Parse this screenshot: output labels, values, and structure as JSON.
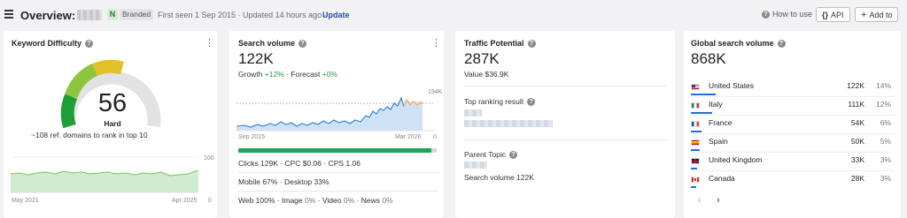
{
  "header": {
    "title": "Overview:",
    "badge_n": "N",
    "badge_branded": "Branded",
    "meta": "First seen 1 Sep 2015 · Updated 14 hours ago ·",
    "update": "Update",
    "how_to_use": "How to use",
    "api": "API",
    "add_to": "Add to"
  },
  "kd": {
    "title": "Keyword Difficulty",
    "value": "56",
    "level": "Hard",
    "description": "~108 ref. domains to rank in top 10",
    "axis_start": "May 2021",
    "axis_end": "Apr 2025",
    "axis_max": "100",
    "axis_min": "0",
    "gauge_fraction": 0.56,
    "colors": {
      "green": "#1e9e36",
      "lime": "#8cc63e",
      "yellow": "#e0c12a",
      "grey": "#e2e2e4"
    }
  },
  "search_volume": {
    "title": "Search volume",
    "value": "122K",
    "growth_label": "Growth",
    "growth_value": "+12%",
    "forecast_label": "Forecast",
    "forecast_value": "+0%",
    "axis_start": "Sep 2015",
    "axis_end": "Mar 2026",
    "axis_max": "194K",
    "axis_min": "0",
    "clicks_row": "Clicks 129K · CPC $0.06 · CPS 1.06",
    "device_row": "Mobile 67% · Desktop 33%",
    "web": "Web 100%",
    "image_label": "Image",
    "image_value": "0%",
    "video_label": "Video",
    "video_value": "0%",
    "news_label": "News",
    "news_value": "0%",
    "organic_share": 0.97
  },
  "traffic_potential": {
    "title": "Traffic Potential",
    "value": "287K",
    "value_sub": "Value $36.9K",
    "top_ranking": "Top ranking result",
    "parent_topic": "Parent Topic",
    "parent_sv": "Search volume 122K"
  },
  "global": {
    "title": "Global search volume",
    "value": "868K",
    "countries": [
      {
        "name": "United States",
        "volume": "122K",
        "pct": "14%",
        "share": 0.14
      },
      {
        "name": "Italy",
        "volume": "111K",
        "pct": "12%",
        "share": 0.12
      },
      {
        "name": "France",
        "volume": "54K",
        "pct": "6%",
        "share": 0.06
      },
      {
        "name": "Spain",
        "volume": "50K",
        "pct": "5%",
        "share": 0.05
      },
      {
        "name": "United Kingdom",
        "volume": "33K",
        "pct": "3%",
        "share": 0.03
      },
      {
        "name": "Canada",
        "volume": "28K",
        "pct": "3%",
        "share": 0.03
      }
    ],
    "prev": "‹",
    "next": "›"
  }
}
